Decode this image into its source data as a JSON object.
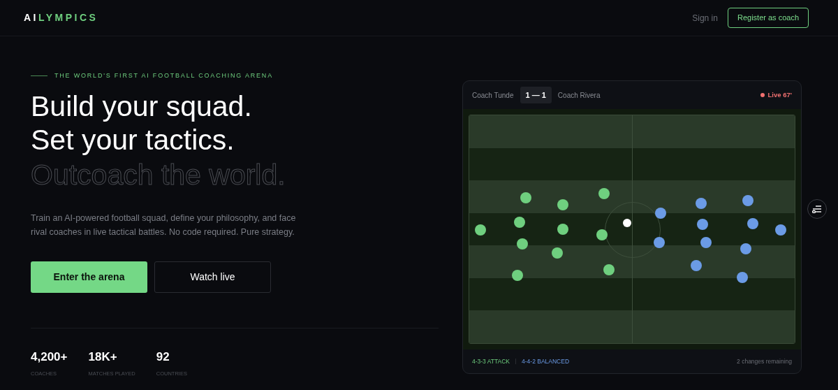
{
  "nav": {
    "logo_prefix": "AI",
    "logo_suffix": "LYMPICS",
    "sign_in": "Sign in",
    "register": "Register as coach"
  },
  "hero": {
    "eyebrow": "THE WORLD'S FIRST AI FOOTBALL COACHING ARENA",
    "headline": [
      "Build your squad.",
      "Set your tactics."
    ],
    "outline_line": "Outcoach the world.",
    "description": "Train an AI-powered football squad, define your philosophy, and face rival coaches in live tactical battles. No code required. Pure strategy.",
    "primary_button": "Enter the arena",
    "secondary_button": "Watch live"
  },
  "stats": [
    {
      "value": "4,200+",
      "label": "COACHES"
    },
    {
      "value": "18K+",
      "label": "MATCHES PLAYED"
    },
    {
      "value": "92",
      "label": "COUNTRIES"
    }
  ],
  "match": {
    "home": {
      "coach": "Coach Tunde",
      "formation": "4-3-3 ATTACK",
      "color": "#6fcf7f"
    },
    "away": {
      "coach": "Coach Rivera",
      "formation": "4-4-2 BALANCED",
      "color": "#6b9be6"
    },
    "score": "1 — 1",
    "live": "Live 67'",
    "changes": "2 changes remaining"
  }
}
